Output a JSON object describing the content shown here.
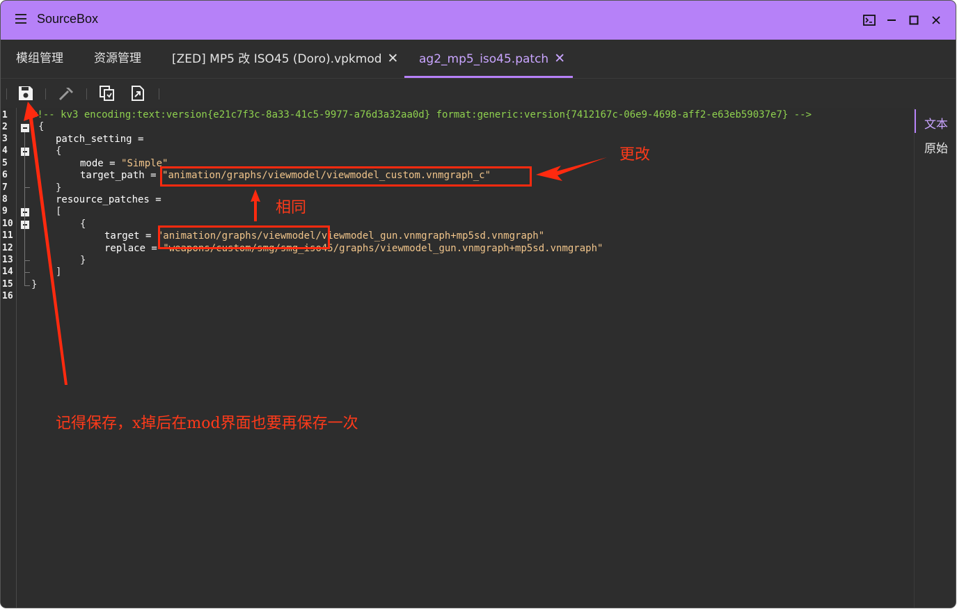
{
  "app": {
    "title": "SourceBox"
  },
  "tabs": [
    {
      "label": "模组管理",
      "closable": false
    },
    {
      "label": "资源管理",
      "closable": false
    },
    {
      "label": "[ZED] MP5 改 ISO45 (Doro).vpkmod",
      "closable": true
    },
    {
      "label": "ag2_mp5_iso45.patch",
      "closable": true,
      "active": true
    }
  ],
  "tab_close_glyph": "✕",
  "toolbar": {
    "items": [
      "save-icon",
      "build-hammer-icon",
      "copy-icon",
      "export-file-icon"
    ]
  },
  "editor": {
    "line_numbers": [
      "1",
      "2",
      "3",
      "4",
      "5",
      "6",
      "7",
      "8",
      "9",
      "10",
      "11",
      "12",
      "13",
      "14",
      "15",
      "16"
    ],
    "lines": {
      "l1": "<!-- kv3 encoding:text:version{e21c7f3c-8a33-41c5-9977-a76d3a32aa0d} format:generic:version{7412167c-06e9-4698-aff2-e63eb59037e7} -->",
      "l2": "{",
      "l3": "patch_setting =",
      "l4": "{",
      "l5_key": "mode = ",
      "l5_val": "\"Simple\"",
      "l6_key": "target_path = ",
      "l6_val": "\"animation/graphs/viewmodel/viewmodel_custom.vnmgraph_c\"",
      "l7": "}",
      "l8": "resource_patches =",
      "l9": "[",
      "l10": "{",
      "l11_key": "target = ",
      "l11_val": "\"animation/graphs/viewmodel/viewmodel_gun.vnmgraph+mp5sd.vnmgraph\"",
      "l12_key": "replace = ",
      "l12_val": "\"weapons/custom/smg/smg_iso45/graphs/viewmodel_gun.vnmgraph+mp5sd.vnmgraph\"",
      "l13": "}",
      "l14": "]",
      "l15": "}"
    }
  },
  "right_panel": {
    "items": [
      "文本",
      "原始"
    ],
    "active": "文本"
  },
  "annotations": {
    "change": "更改",
    "same": "相同",
    "save_note": "记得保存，x掉后在mod界面也要再保存一次"
  },
  "colors": {
    "titlebar": "#b681f8",
    "accent": "#c9a5ff",
    "background": "#2e2e2e",
    "annotation": "#ff2a0f",
    "comment": "#8fd14f",
    "string": "#f1c58b"
  }
}
